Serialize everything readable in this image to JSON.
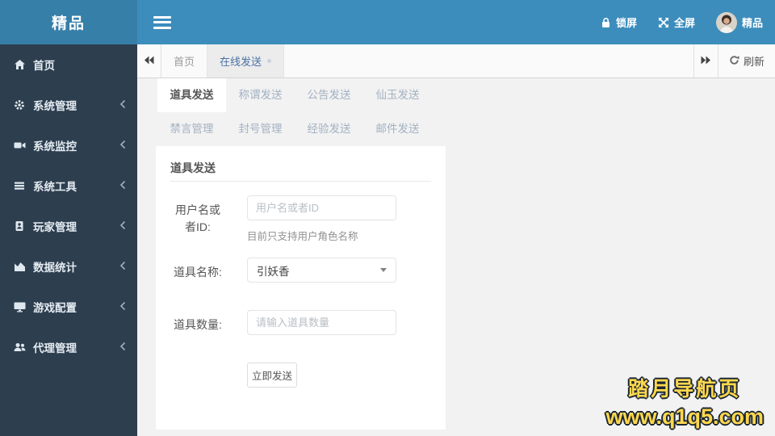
{
  "brand": {
    "logo": "精品"
  },
  "navbar": {
    "lock_label": "锁屏",
    "fullscreen_label": "全屏",
    "user_name": "精品"
  },
  "tabbar": {
    "tabs": [
      {
        "label": "首页",
        "active": false
      },
      {
        "label": "在线发送",
        "active": true,
        "closable": true
      }
    ],
    "refresh_label": "刷新"
  },
  "sidebar": {
    "items": [
      {
        "label": "首页",
        "icon": "home-icon",
        "has_children": false
      },
      {
        "label": "系统管理",
        "icon": "gear-icon",
        "has_children": true
      },
      {
        "label": "系统监控",
        "icon": "video-camera-icon",
        "has_children": true
      },
      {
        "label": "系统工具",
        "icon": "list-icon",
        "has_children": true
      },
      {
        "label": "玩家管理",
        "icon": "id-card-icon",
        "has_children": true
      },
      {
        "label": "数据统计",
        "icon": "area-chart-icon",
        "has_children": true
      },
      {
        "label": "游戏配置",
        "icon": "desktop-icon",
        "has_children": true
      },
      {
        "label": "代理管理",
        "icon": "users-icon",
        "has_children": true
      }
    ]
  },
  "content": {
    "tabs_row1": [
      "道具发送",
      "称谓发送",
      "公告发送",
      "仙玉发送"
    ],
    "tabs_row2": [
      "禁言管理",
      "封号管理",
      "经验发送",
      "邮件发送"
    ],
    "active_tab": "道具发送",
    "panel": {
      "title": "道具发送",
      "fields": [
        {
          "label": "用户名或者ID:",
          "type": "input",
          "placeholder": "用户名或者ID",
          "value": "",
          "helper": "目前只支持用户角色名称"
        },
        {
          "label": "道具名称:",
          "type": "select",
          "value": "引妖香"
        },
        {
          "label": "道具数量:",
          "type": "input",
          "placeholder": "请输入道具数量",
          "value": ""
        }
      ],
      "submit_label": "立即发送"
    }
  },
  "watermark": {
    "line1": "踏月导航页",
    "line2": "www.q1q5.com"
  },
  "colors": {
    "navbar": "#3c8dbc",
    "logo_bg": "#367fa9",
    "sidebar": "#2d3e4f",
    "tab_active_text": "#4a72a5",
    "content_bg": "#f2f2f2",
    "watermark_text": "#ffd84d"
  }
}
